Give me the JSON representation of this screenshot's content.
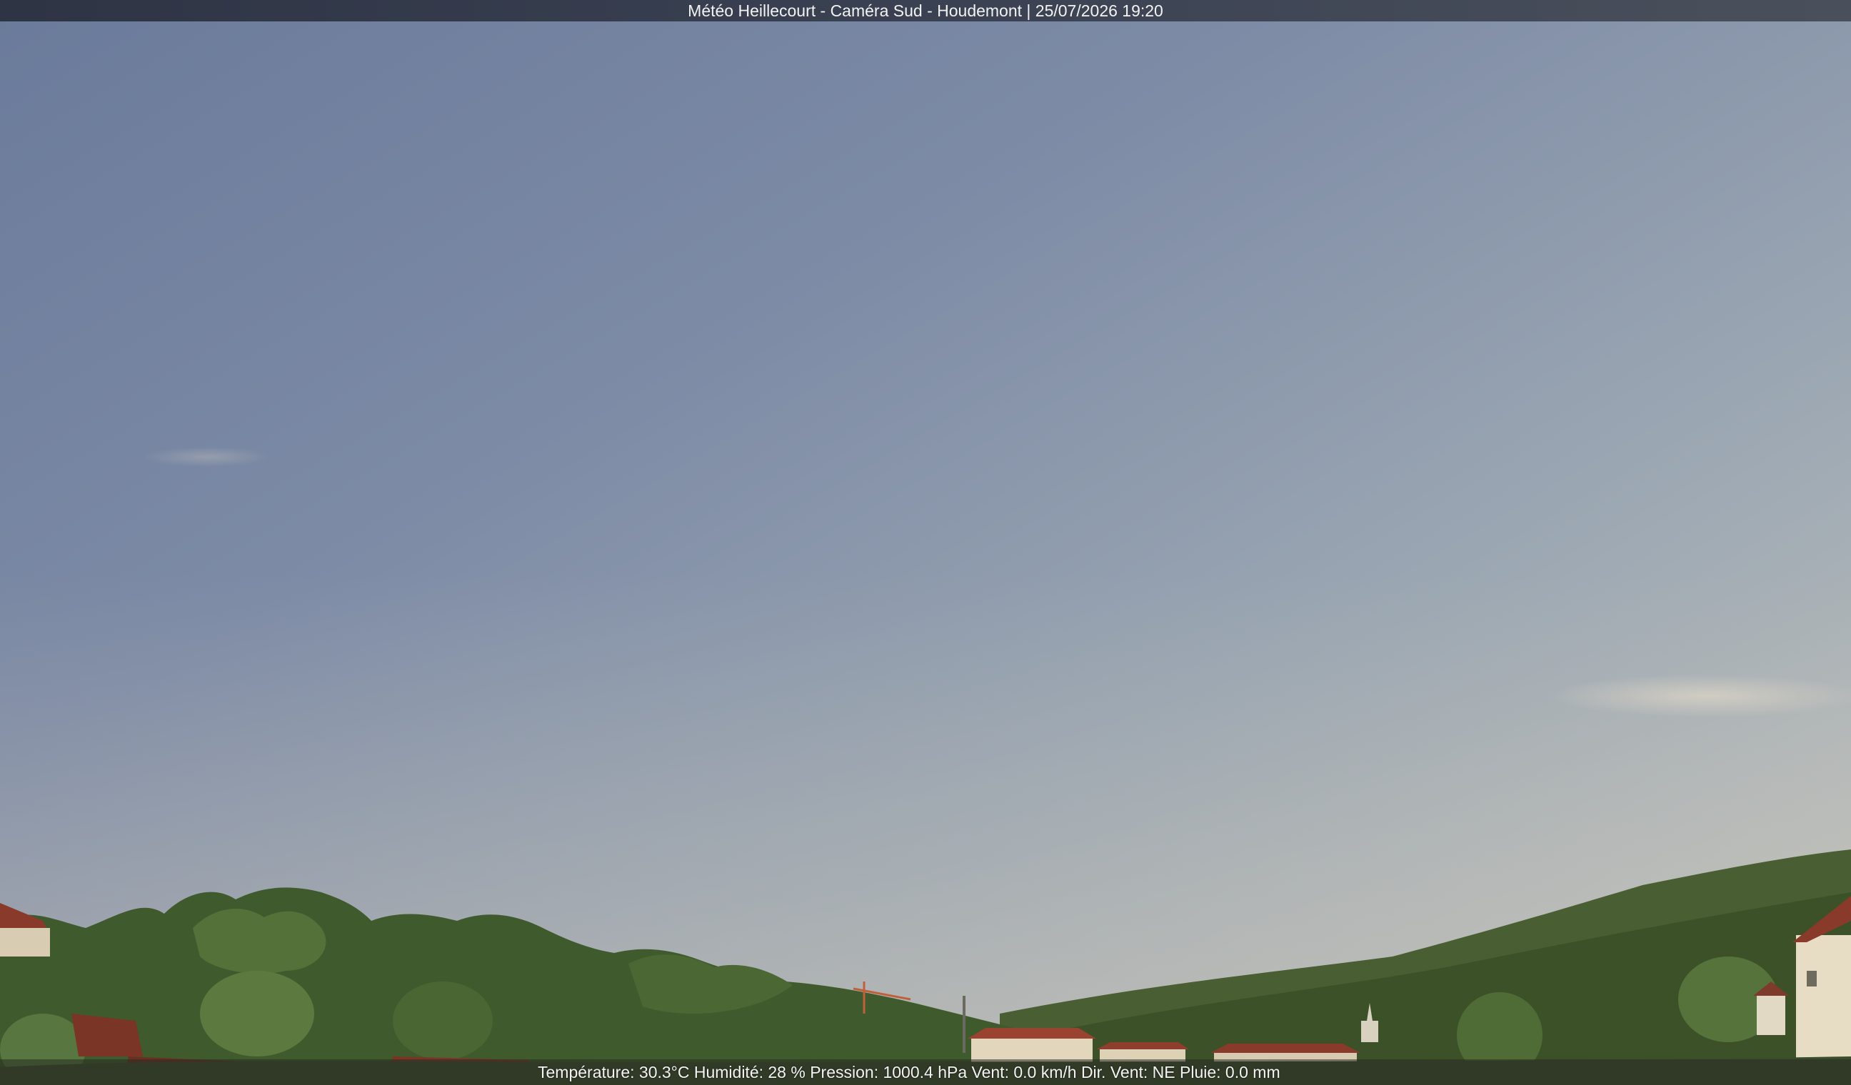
{
  "overlay": {
    "title": "Météo Heillecourt - Caméra Sud - Houdemont | 25/07/2026 19:20",
    "weather_line": "Température: 30.3°C  Humidité: 28 % Pression: 1000.4 hPa Vent: 0.0 km/h Dir. Vent: NE Pluie: 0.0 mm"
  },
  "colors": {
    "sky_top": "#6f7f9e",
    "sky_mid": "#8e9bb0",
    "sky_horizon": "#b7bcbc",
    "foliage": "#3d5a2a",
    "roof": "#8a3a2a",
    "house_wall": "#e7ddc4"
  }
}
